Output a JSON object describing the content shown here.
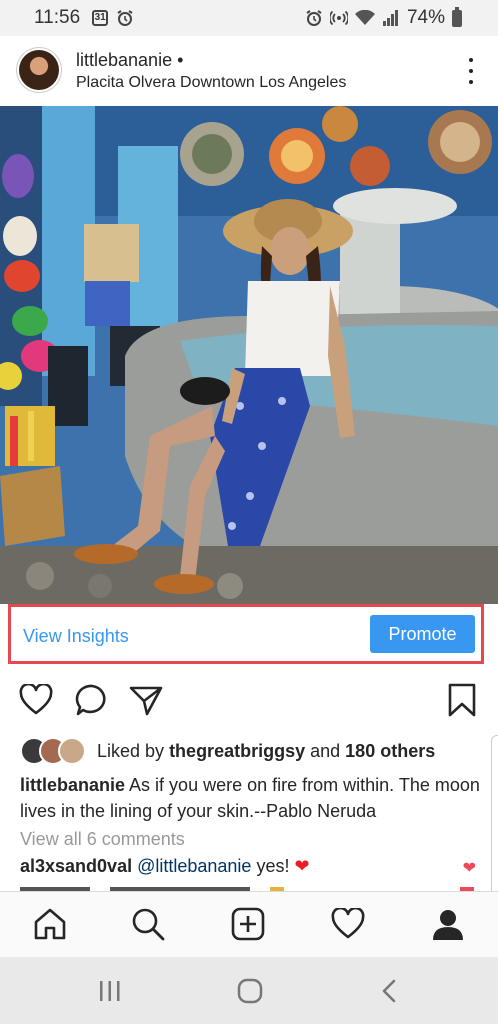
{
  "status_bar": {
    "time": "11:56",
    "calendar_date": "31",
    "battery": "74%",
    "icons": [
      "calendar-icon",
      "alarm-icon",
      "alarm-icon",
      "hotspot-icon",
      "wifi-icon",
      "signal-icon",
      "battery-icon"
    ]
  },
  "post": {
    "username": "littlebananie •",
    "location": "Placita Olvera Downtown Los Angeles",
    "insights_link": "View Insights",
    "promote_button": "Promote",
    "likes_prefix": "Liked by",
    "liked_by_user": "thegreatbriggsy",
    "likes_and": "and",
    "likes_others": "180 others",
    "caption_user": "littlebananie",
    "caption_text": "As if you were on fire from within. The moon lives in the lining of your skin.--Pablo Neruda",
    "view_comments": "View all 6 comments",
    "comment": {
      "user": "al3xsand0val",
      "mention": "@littlebananie",
      "text": "yes!",
      "emoji": "❤"
    }
  },
  "colors": {
    "accent": "#3897f0",
    "highlight_border": "#e5484d",
    "like_red": "#ed4956"
  },
  "bottom_nav": [
    "home-icon",
    "search-icon",
    "add-post-icon",
    "activity-heart-icon",
    "profile-icon"
  ],
  "system_nav": [
    "recents-icon",
    "home-circle-icon",
    "back-icon"
  ]
}
